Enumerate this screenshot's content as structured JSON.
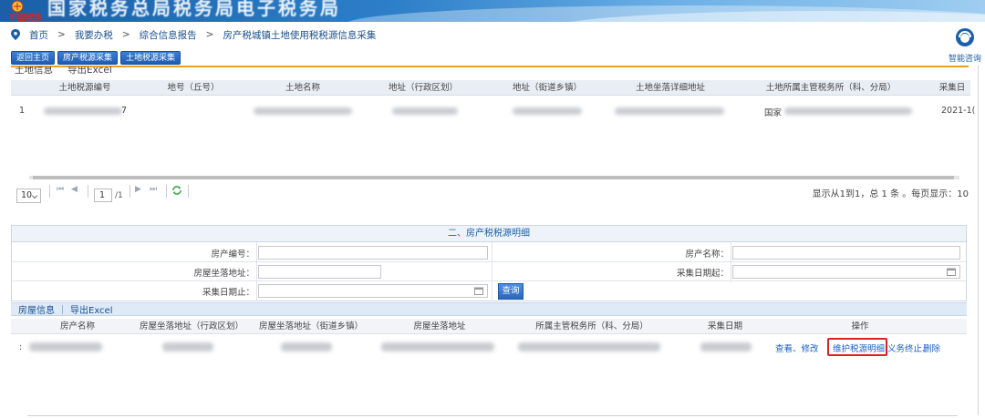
{
  "banner": {
    "title": "国家税务总局税务局电子税务局",
    "logo_text": "中国税务",
    "colors": {
      "banner_start": "#1a5fa8",
      "banner_end": "#9fcdf0"
    }
  },
  "breadcrumb": {
    "items": [
      "首页",
      "我要办税",
      "综合信息报告",
      "房产税城镇土地使用税税源信息采集"
    ],
    "separator": ">"
  },
  "assistant": {
    "label": "智能咨询"
  },
  "toolbar": {
    "back_label": "返回主页",
    "house_collect_label": "房产税源采集",
    "land_collect_label": "土地税源采集"
  },
  "land": {
    "tab_info": "土地信息",
    "tab_export": "导出Excel",
    "columns": [
      "土地税源编号",
      "地号（丘号）",
      "土地名称",
      "地址（行政区划）",
      "地址（街道乡镇）",
      "土地坐落详细地址",
      "土地所属主管税务所（科、分局）",
      "采集日"
    ],
    "rows": [
      {
        "num": "1",
        "source_no_tail": "7",
        "tax_office_prefix": "国家",
        "date": "2021-1("
      }
    ]
  },
  "pager": {
    "page_size": "10",
    "current_page": "1",
    "total_pages": "/1",
    "summary": "显示从1到1，总 1 条 。每页显示：10"
  },
  "section2": {
    "title": "二、房产税税源明细",
    "fields": {
      "house_no": "房产编号：",
      "house_name": "房产名称：",
      "house_address": "房屋坐落地址：",
      "collect_start": "采集日期起：",
      "collect_end": "采集日期止："
    },
    "query_label": "查询"
  },
  "house": {
    "tab_info": "房屋信息",
    "tab_export": "导出Excel",
    "columns": [
      "房产名称",
      "房屋坐落地址（行政区划）",
      "房屋坐落地址（街道乡镇）",
      "房屋坐落地址",
      "所属主管税务所（科、分局）",
      "采集日期",
      "操作"
    ],
    "rows": [
      {
        "num": ":",
        "ops": {
          "view_edit": "查看、修改",
          "maintain": "维护税源明细、",
          "terminate": "义务终止、",
          "delete": "删除"
        }
      }
    ]
  }
}
